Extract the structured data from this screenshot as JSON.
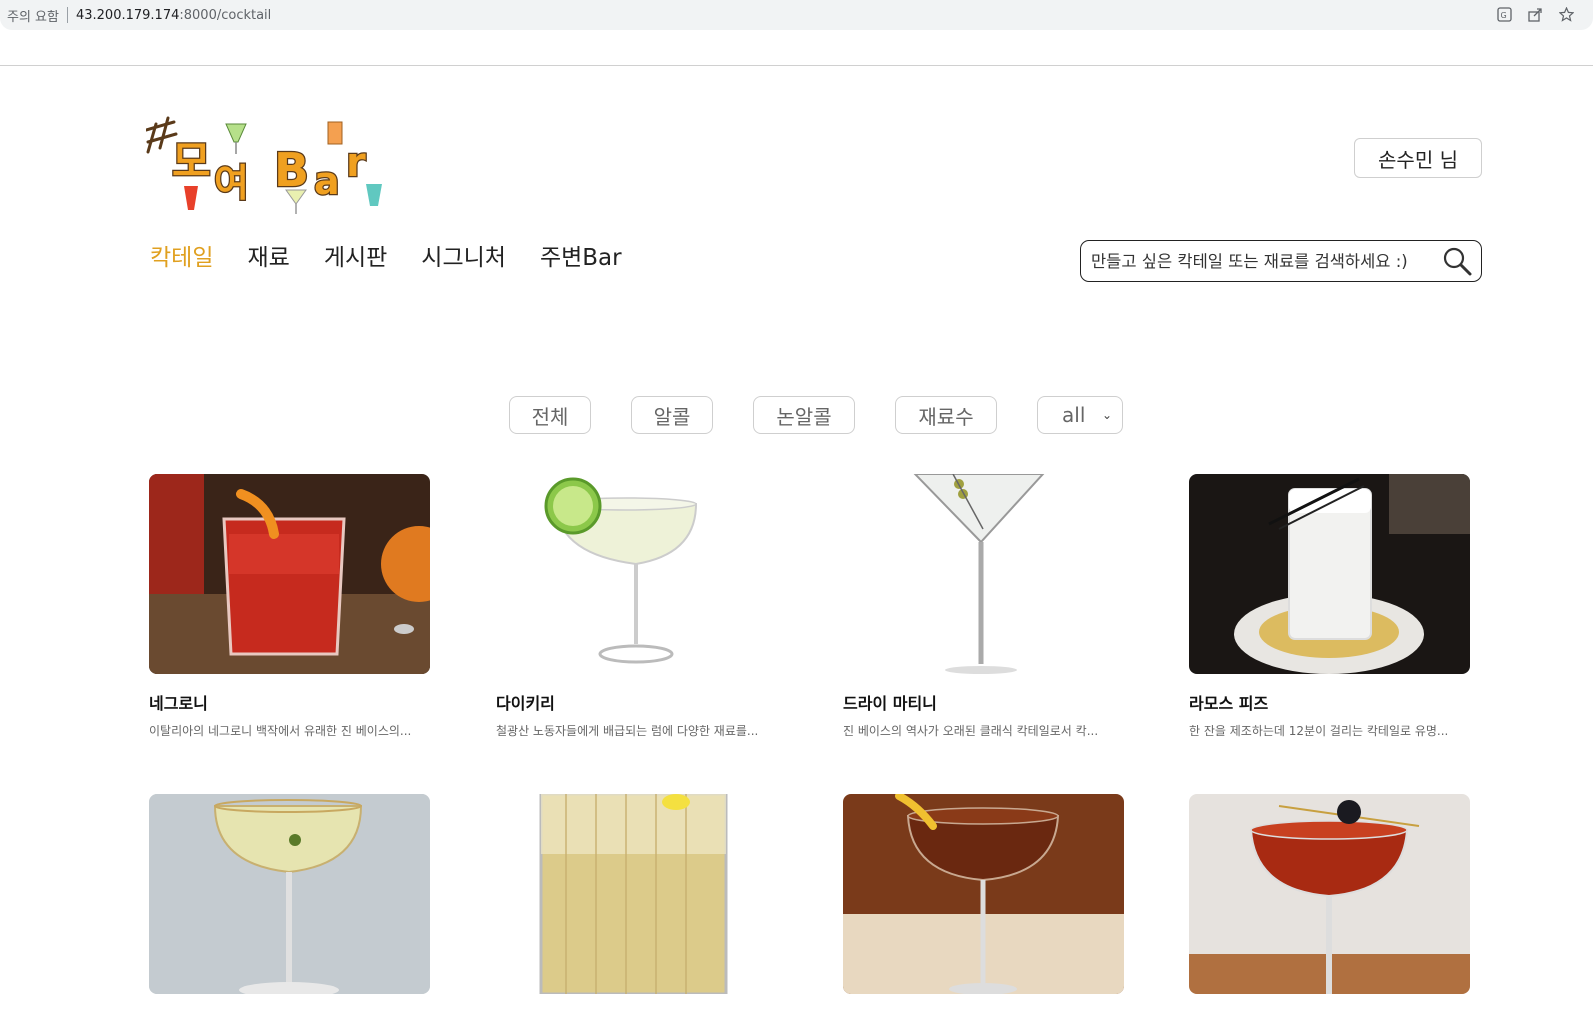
{
  "browser": {
    "warning": "주의 요함",
    "url_host": "43.200.179.174",
    "url_path": ":8000/cocktail"
  },
  "header": {
    "user_label": "손수민 님",
    "search_placeholder": "만들고 싶은 칵테일 또는 재료를 검색하세요 :)"
  },
  "nav": {
    "items": [
      {
        "label": "칵테일",
        "active": true
      },
      {
        "label": "재료"
      },
      {
        "label": "게시판"
      },
      {
        "label": "시그니처"
      },
      {
        "label": "주변Bar"
      }
    ]
  },
  "filters": {
    "all": "전체",
    "alcohol": "알콜",
    "non_alcohol": "논알콜",
    "ingredient_count": "재료수",
    "select_value": "all"
  },
  "cocktails": [
    {
      "name": "네그로니",
      "desc": "이탈리아의 네그로니 백작에서 유래한 진 베이스의..."
    },
    {
      "name": "다이키리",
      "desc": "철광산 노동자들에게 배급되는 럼에 다양한 재료를..."
    },
    {
      "name": "드라이 마티니",
      "desc": "진 베이스의 역사가 오래된 클래식 칵테일로서 칵..."
    },
    {
      "name": "라모스 피즈",
      "desc": "한 잔을 제조하는데 12분이 걸리는 칵테일로 유명..."
    },
    {
      "name": "",
      "desc": ""
    },
    {
      "name": "",
      "desc": ""
    },
    {
      "name": "",
      "desc": ""
    },
    {
      "name": "",
      "desc": ""
    }
  ],
  "colors": {
    "accent": "#e0a020",
    "logo_orange": "#f0a020",
    "logo_brown": "#5a3a1a"
  }
}
